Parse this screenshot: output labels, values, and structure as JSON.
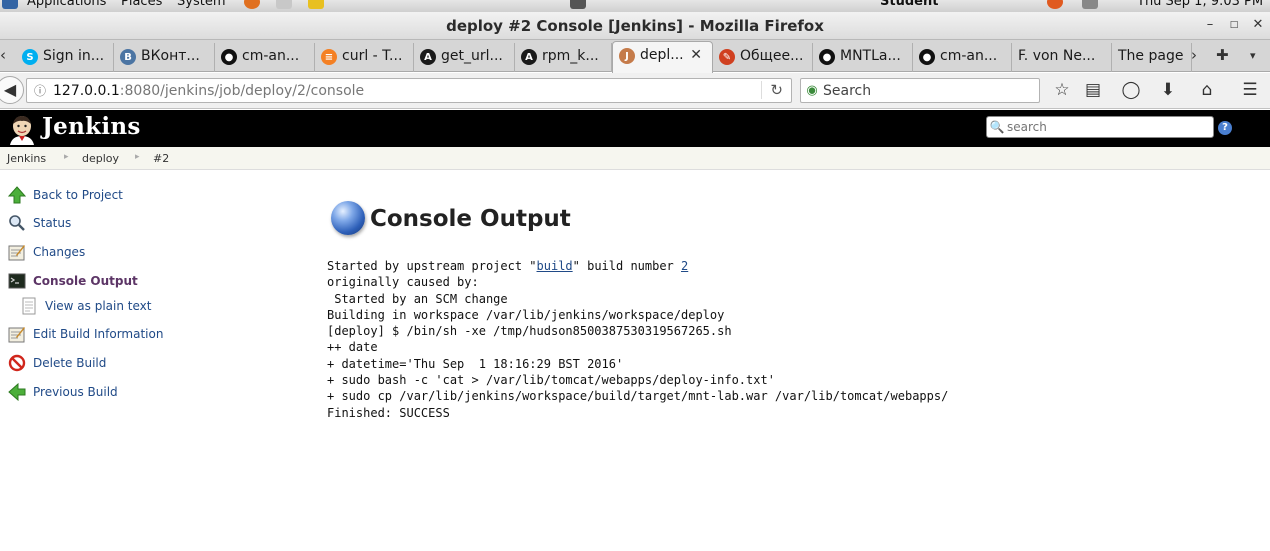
{
  "panel": {
    "applications": "Applications",
    "places": "Places",
    "system": "System",
    "user": "Student",
    "clock": "Thu Sep  1, 9:03 PM"
  },
  "window": {
    "title": "deploy #2 Console [Jenkins] - Mozilla Firefox"
  },
  "tabs": [
    {
      "label": "Sign in...",
      "icon": "skype-icon",
      "color": "#00aff0"
    },
    {
      "label": "ВКонт...",
      "icon": "vk-icon",
      "color": "#4c75a3"
    },
    {
      "label": "cm-an...",
      "icon": "github-icon",
      "color": "#111111"
    },
    {
      "label": "curl - T...",
      "icon": "stackoverflow-icon",
      "color": "#f48024"
    },
    {
      "label": "get_url...",
      "icon": "ansible-icon",
      "color": "#1a1a1a"
    },
    {
      "label": "rpm_k...",
      "icon": "ansible-icon",
      "color": "#1a1a1a"
    },
    {
      "label": "depl...",
      "icon": "jenkins-icon",
      "color": "#c57b4a"
    },
    {
      "label": "Общее...",
      "icon": "edit-icon",
      "color": "#d04020"
    },
    {
      "label": "MNTLa...",
      "icon": "github-icon",
      "color": "#111111"
    },
    {
      "label": "cm-an...",
      "icon": "github-icon",
      "color": "#111111"
    },
    {
      "label": "F. von Ne...",
      "icon": "",
      "color": ""
    },
    {
      "label": "The page",
      "icon": "",
      "color": ""
    }
  ],
  "navbar": {
    "url_host": "127.0.0.1",
    "url_path": ":8080/jenkins/job/deploy/2/console",
    "search_placeholder": "Search"
  },
  "jenkins": {
    "brand": "Jenkins",
    "search_placeholder": "search",
    "help": "?"
  },
  "breadcrumb": [
    "Jenkins",
    "deploy",
    "#2"
  ],
  "sidebar": {
    "items": [
      {
        "label": "Back to Project",
        "icon": "up-arrow-icon"
      },
      {
        "label": "Status",
        "icon": "magnifier-icon"
      },
      {
        "label": "Changes",
        "icon": "notepad-icon"
      },
      {
        "label": "Console Output",
        "icon": "terminal-icon"
      },
      {
        "label": "View as plain text",
        "icon": "document-icon"
      },
      {
        "label": "Edit Build Information",
        "icon": "notepad-icon"
      },
      {
        "label": "Delete Build",
        "icon": "no-entry-icon"
      },
      {
        "label": "Previous Build",
        "icon": "left-arrow-icon"
      }
    ]
  },
  "main": {
    "title": "Console Output",
    "console": {
      "l1_pre": "Started by upstream project \"",
      "l1_link1": "build",
      "l1_mid": "\" build number ",
      "l1_link2": "2",
      "lines": [
        "originally caused by:",
        " Started by an SCM change",
        "Building in workspace /var/lib/jenkins/workspace/deploy",
        "[deploy] $ /bin/sh -xe /tmp/hudson8500387530319567265.sh",
        "++ date",
        "+ datetime='Thu Sep  1 18:16:29 BST 2016'",
        "+ sudo bash -c 'cat > /var/lib/tomcat/webapps/deploy-info.txt'",
        "+ sudo cp /var/lib/jenkins/workspace/build/target/mnt-lab.war /var/lib/tomcat/webapps/",
        "Finished: SUCCESS"
      ]
    }
  }
}
